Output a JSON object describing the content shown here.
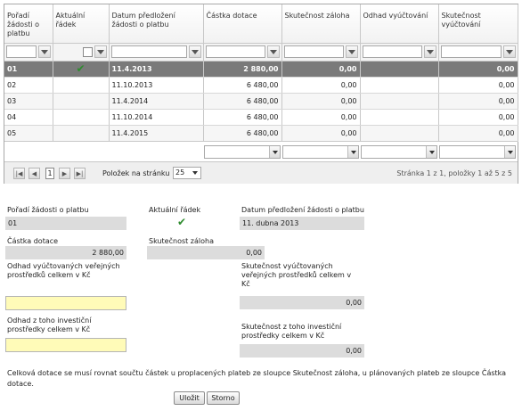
{
  "grid": {
    "columns": [
      "Pořadí žádosti o platbu",
      "Aktuální řádek",
      "Datum předložení žádosti o platbu",
      "Částka dotace",
      "Skutečnost záloha",
      "Odhad vyúčtování",
      "Skutečnost vyúčtování"
    ],
    "rows": [
      {
        "poradi": "01",
        "aktualni": true,
        "datum": "11.4.2013",
        "castka": "2 880,00",
        "zaloha": "0,00",
        "odhad": "",
        "skut": "0,00",
        "selected": true
      },
      {
        "poradi": "02",
        "aktualni": false,
        "datum": "11.10.2013",
        "castka": "6 480,00",
        "zaloha": "0,00",
        "odhad": "",
        "skut": "0,00"
      },
      {
        "poradi": "03",
        "aktualni": false,
        "datum": "11.4.2014",
        "castka": "6 480,00",
        "zaloha": "0,00",
        "odhad": "",
        "skut": "0,00"
      },
      {
        "poradi": "04",
        "aktualni": false,
        "datum": "11.10.2014",
        "castka": "6 480,00",
        "zaloha": "0,00",
        "odhad": "",
        "skut": "0,00"
      },
      {
        "poradi": "05",
        "aktualni": false,
        "datum": "11.4.2015",
        "castka": "6 480,00",
        "zaloha": "0,00",
        "odhad": "",
        "skut": "0,00"
      }
    ],
    "pager": {
      "current_page": "1",
      "page_size_label": "Položek na stránku",
      "page_size": "25",
      "summary": "Stránka 1 z 1, položky 1 až 5 z 5"
    }
  },
  "form": {
    "poradi_label": "Pořadí žádosti o platbu",
    "poradi_value": "01",
    "aktualni_label": "Aktuální řádek",
    "datum_label": "Datum předložení žádosti o platbu",
    "datum_value": "11. dubna 2013",
    "castka_label": "Částka dotace",
    "castka_value": "2 880,00",
    "zaloha_label": "Skutečnost záloha",
    "zaloha_value": "0,00",
    "odhad_vyuct_label": "Odhad vyúčtovaných veřejných prostředků celkem v Kč",
    "odhad_vyuct_value": "",
    "skut_vyuct_label": "Skutečnost vyúčtovaných veřejných prostředků celkem v Kč",
    "skut_vyuct_value": "0,00",
    "odhad_invest_label": "Odhad z toho investiční prostředky celkem v Kč",
    "odhad_invest_value": "",
    "skut_invest_label": "Skutečnost z toho investiční prostředky celkem v Kč",
    "skut_invest_value": "0,00",
    "note": "Celková dotace se musí rovnat součtu částek u proplacených plateb ze sloupce Skutečnost záloha, u plánovaných plateb ze sloupce Částka dotace.",
    "save_label": "Uložit",
    "cancel_label": "Storno"
  },
  "icons": {
    "check": "check-icon",
    "filter": "filter-icon",
    "first": "first-page-icon",
    "prev": "prev-page-icon",
    "next": "next-page-icon",
    "last": "last-page-icon",
    "dropdown": "chevron-down-icon"
  },
  "colors": {
    "selected_row": "#7a7a7a",
    "check": "#2e8b2e",
    "editable_field": "#fffbb8",
    "readonly_field": "#dcdcdc"
  }
}
